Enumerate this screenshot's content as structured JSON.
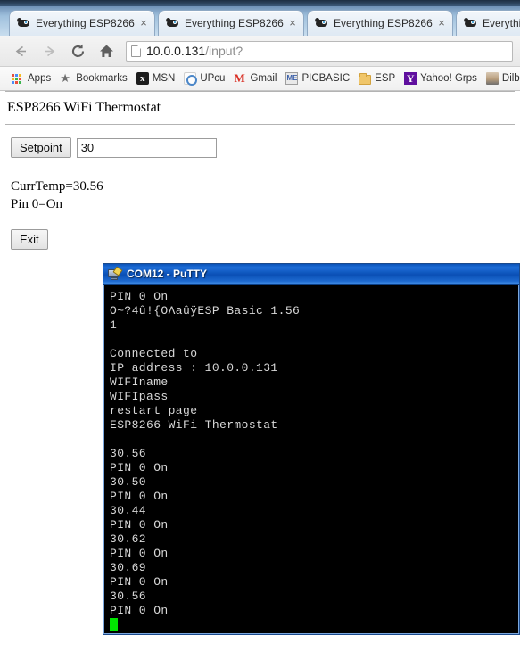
{
  "browser": {
    "tabs": [
      {
        "title": "Everything ESP8266 -",
        "favicon": "esp8266-favicon",
        "close_label": "×",
        "active": false
      },
      {
        "title": "Everything ESP8266 -",
        "favicon": "esp8266-favicon",
        "close_label": "×",
        "active": false
      },
      {
        "title": "Everything ESP8266 -",
        "favicon": "esp8266-favicon",
        "close_label": "×",
        "active": false
      },
      {
        "title": "Everything",
        "favicon": "esp8266-favicon",
        "close_label": "×",
        "active": true
      }
    ],
    "nav": {
      "back_icon": "back-arrow-icon",
      "forward_icon": "forward-arrow-icon",
      "reload_icon": "reload-icon",
      "home_icon": "home-icon"
    },
    "omnibox": {
      "url_host": "10.0.0.131",
      "url_path": "/input?",
      "page_icon": "document-icon"
    },
    "bookmarks": [
      {
        "label": "Apps",
        "icon": "apps-grid-icon"
      },
      {
        "label": "Bookmarks",
        "icon": "star-icon"
      },
      {
        "label": "MSN",
        "icon": "msn-icon"
      },
      {
        "label": "UPcu",
        "icon": "upcu-icon"
      },
      {
        "label": "Gmail",
        "icon": "gmail-icon"
      },
      {
        "label": "PICBASIC",
        "icon": "picbasic-icon"
      },
      {
        "label": "ESP",
        "icon": "folder-icon"
      },
      {
        "label": "Yahoo! Grps",
        "icon": "yahoo-icon"
      },
      {
        "label": "Dilbe",
        "icon": "dilbert-icon"
      }
    ]
  },
  "page": {
    "heading": "ESP8266 WiFi Thermostat",
    "setpoint_button": "Setpoint",
    "setpoint_value": "30",
    "setpoint_placeholder": "",
    "current_temp_line": "CurrTemp=30.56",
    "pin_state_line": "Pin 0=On",
    "exit_button": "Exit"
  },
  "putty": {
    "title": "COM12 - PuTTY",
    "lines": [
      "PIN 0 On",
      "O~?4û!{OΛaûÿESP Basic 1.56",
      "1",
      "",
      "Connected to",
      "IP address : 10.0.0.131",
      "WIFIname",
      "WIFIpass",
      "restart page",
      "ESP8266 WiFi Thermostat",
      "",
      "30.56",
      "PIN 0 On",
      "30.50",
      "PIN 0 On",
      "30.44",
      "PIN 0 On",
      "30.62",
      "PIN 0 On",
      "30.69",
      "PIN 0 On",
      "30.56",
      "PIN 0 On"
    ],
    "cursor": "block-cursor"
  },
  "colors": {
    "tabstrip": "#9fc0dd",
    "putty_titlebar": "#1e6ed8",
    "terminal_bg": "#000000",
    "terminal_fg": "#d8d8d8",
    "cursor_green": "#00e600"
  }
}
